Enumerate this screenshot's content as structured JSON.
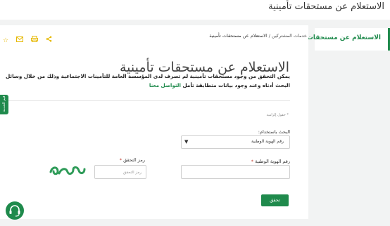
{
  "window": {
    "title": "الاستعلام عن مستحقات تأمينية"
  },
  "sidebar": {
    "items": [
      {
        "label": "الاستعلام عن مستحقات تأمينية"
      }
    ]
  },
  "breadcrumb": {
    "parent": "خدمات المشتركين",
    "separator": "/",
    "current": "الاستعلام عن مستحقات تأمينية"
  },
  "page": {
    "title": "الاستعلام عن مستحقات تأمينية",
    "description": "يمكن التحقق من وجود مستحقات تأمينية لم تصرف لدى المؤسسة العامة للتأمينات الاجتماعية وذلك من خلال وسائل البحث أدناه وعند وجود بيانات متطابقة تأمل",
    "contact_link": "التواصل معنا"
  },
  "side_tab": {
    "label": "قيم الخدمة"
  },
  "form": {
    "required_note": "* حقول إلزامية",
    "search_by_label": "البحث باستخدام:",
    "search_by_value": "رقم الهوية الوطنية",
    "id_label": "رقم الهوية الوطنية",
    "id_placeholder": "",
    "captcha_label": "رمز التحقق",
    "captcha_placeholder": "رمز التحقق",
    "captcha_text": "ཨེ",
    "required_star": "*",
    "submit_label": "تحقق"
  },
  "icons": {
    "share": "share-icon",
    "print": "print-icon",
    "email": "email-icon",
    "favorite": "star-icon",
    "chat": "chat-support-icon",
    "dropdown": "chevron-down-icon"
  },
  "colors": {
    "accent": "#1f8a4c",
    "star": "#e6b800"
  }
}
